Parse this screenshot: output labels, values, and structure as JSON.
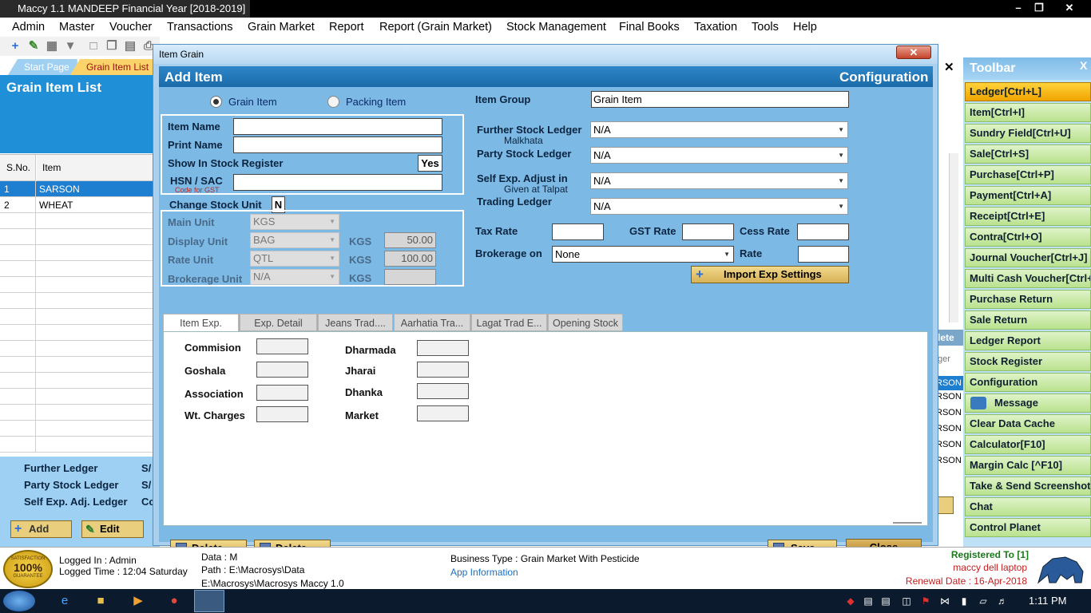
{
  "window": {
    "title": "Maccy 1.1 MANDEEP Financial Year [2018-2019]"
  },
  "menu": [
    "Admin",
    "Master",
    "Voucher",
    "Transactions",
    "Grain Market",
    "Report",
    "Report (Grain Market)",
    "Stock Management",
    "Final Books",
    "Taxation",
    "Tools",
    "Help"
  ],
  "left_tabs": {
    "start": "Start Page",
    "active": "Grain Item List"
  },
  "list": {
    "title": "Grain Item List",
    "col_sno": "S.No.",
    "col_item": "Item",
    "rows": [
      {
        "sno": "1",
        "item": "SARSON"
      },
      {
        "sno": "2",
        "item": "WHEAT"
      }
    ]
  },
  "left_bottom": {
    "further_ledger": "Further Ledger",
    "party_stock_ledger": "Party Stock Ledger",
    "self_exp_adj_ledger": "Self Exp. Adj. Ledger",
    "fl_val": "S/",
    "ps_val": "S/",
    "se_val": "Co",
    "add": "Add",
    "edit": "Edit"
  },
  "right_strip": {
    "delete_partial": "lete",
    "ledger_partial": "ger",
    "rows": [
      "RSON",
      "RSON",
      "RSON",
      "RSON",
      "RSON",
      "RSON"
    ]
  },
  "dialog": {
    "title": "Item Grain",
    "header": "Add Item",
    "configuration": "Configuration",
    "grain_item": "Grain Item",
    "packing_item": "Packing Item",
    "item_group_label": "Item Group",
    "item_group_value": "Grain Item",
    "item_name_label": "Item Name",
    "print_name_label": "Print Name",
    "show_in_stock_label": "Show In Stock Register",
    "show_in_stock_value": "Yes",
    "hsn_label": "HSN / SAC",
    "hsn_sub": "Code for GST",
    "change_stock_label": "Change Stock Unit",
    "change_stock_value": "N",
    "main_unit_label": "Main Unit",
    "main_unit_value": "KGS",
    "display_unit_label": "Display Unit",
    "display_unit_value": "BAG",
    "display_unit_kgs": "KGS",
    "display_unit_qty": "50.00",
    "rate_unit_label": "Rate Unit",
    "rate_unit_value": "QTL",
    "rate_unit_kgs": "KGS",
    "rate_unit_qty": "100.00",
    "brokerage_unit_label": "Brokerage Unit",
    "brokerage_unit_value": "N/A",
    "brokerage_unit_kgs": "KGS",
    "further_stock_label": "Further Stock Ledger",
    "further_stock_sub": "Malkhata",
    "further_stock_value": "N/A",
    "party_stock_label": "Party Stock Ledger",
    "party_stock_value": "N/A",
    "self_exp_label": "Self Exp. Adjust in",
    "self_exp_sub": "Given at Talpat",
    "self_exp_value": "N/A",
    "trading_label": "Trading Ledger",
    "trading_value": "N/A",
    "tax_rate_label": "Tax Rate",
    "gst_rate_label": "GST Rate",
    "cess_rate_label": "Cess Rate",
    "brokerage_on_label": "Brokerage on",
    "brokerage_on_value": "None",
    "rate_label": "Rate",
    "import_exp": "Import Exp Settings",
    "tabs": [
      "Item Exp.",
      "Exp. Detail",
      "Jeans Trad....",
      "Aarhatia Tra...",
      "Lagat Trad E...",
      "Opening Stock"
    ],
    "exp_left": [
      "Commision",
      "Goshala",
      "Association",
      "Wt. Charges"
    ],
    "exp_right": [
      "Dharmada",
      "Jharai",
      "Dhanka",
      "Market"
    ],
    "delete1": "Delete",
    "delete2": "Delete",
    "save": "Save",
    "close": "Close"
  },
  "toolbar": {
    "title": "Toolbar",
    "close": "X",
    "items": [
      "Ledger[Ctrl+L]",
      "Item[Ctrl+I]",
      "Sundry Field[Ctrl+U]",
      "Sale[Ctrl+S]",
      "Purchase[Ctrl+P]",
      "Payment[Ctrl+A]",
      "Receipt[Ctrl+E]",
      "Contra[Ctrl+O]",
      "Journal Voucher[Ctrl+J]",
      "Multi Cash Voucher[Ctrl+",
      "Purchase Return",
      "Sale Return",
      "Ledger Report",
      "Stock Register",
      "Configuration",
      "Message",
      "Clear Data Cache",
      "Calculator[F10]",
      "Margin Calc [^F10]",
      "Take & Send Screenshot",
      "Chat",
      "Control Planet"
    ]
  },
  "status": {
    "badge_top": "SATISFACTION",
    "badge_pct": "100%",
    "badge_bottom": "GUARANTEE",
    "logged_in": "Logged In : Admin",
    "logged_time": "Logged Time : 12:04 Saturday",
    "data": "Data : M",
    "path": "Path : E:\\Macrosys\\Data",
    "exe_path": "E:\\Macrosys\\Macrosys Maccy 1.0",
    "business_type": "Business Type : Grain Market With Pesticide",
    "app_info": "App Information",
    "registered": "Registered To [1]",
    "registered_name": "maccy dell laptop",
    "renewal": "Renewal Date : 16-Apr-2018"
  },
  "taskbar": {
    "clock": "1:11 PM"
  },
  "colors": {
    "accent_blue": "#1f8fd8",
    "selected_row": "#1e7fd1",
    "dialog_header": "#1a6aa9",
    "toolbar_green": "#b9e28e",
    "toolbar_highlight": "#f0a500",
    "button_gold": "#d7b257"
  }
}
